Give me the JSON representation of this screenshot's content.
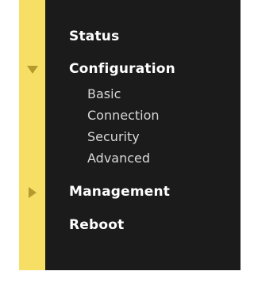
{
  "nav": {
    "status_label": "Status",
    "configuration_label": "Configuration",
    "configuration_children": [
      "Basic",
      "Connection",
      "Security",
      "Advanced"
    ],
    "management_label": "Management",
    "reboot_label": "Reboot"
  },
  "colors": {
    "strip": "#f7df66",
    "panel": "#1b1b1b",
    "arrow": "#b49a2e"
  },
  "icons": {
    "configuration_arrow": "expanded-arrow-icon",
    "management_arrow": "collapsed-arrow-icon"
  }
}
